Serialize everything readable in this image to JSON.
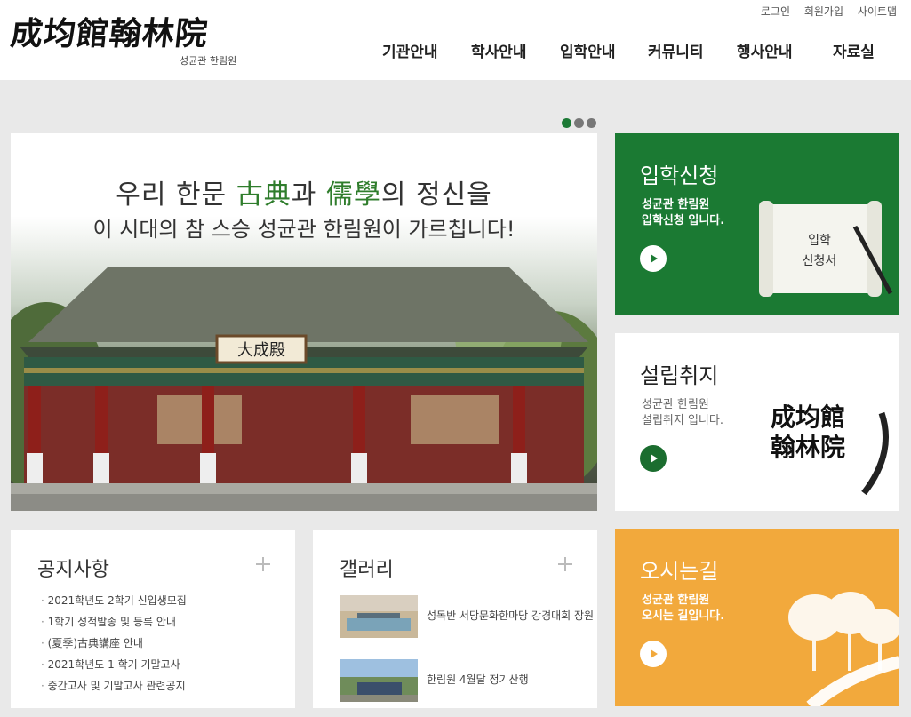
{
  "header": {
    "logo_hanja": "成均館翰林院",
    "logo_sub": "성균관 한림원",
    "util": {
      "login": "로그인",
      "join": "회원가입",
      "sitemap": "사이트맵"
    },
    "nav": [
      "기관안내",
      "학사안내",
      "입학안내",
      "커뮤니티",
      "행사안내",
      "자료실"
    ]
  },
  "hero": {
    "line1_pre": "우리 한문 ",
    "line1_hanja1": "古典",
    "line1_mid": "과 ",
    "line1_hanja2": "儒學",
    "line1_post": "의 정신을",
    "line2": "이 시대의 참 스승 성균관 한림원이 가르칩니다!",
    "plaque": "大成殿",
    "slides": 3,
    "active_slide": 1
  },
  "cards": {
    "apply": {
      "title": "입학신청",
      "desc_line1": "성균관 한림원",
      "desc_line2": "입학신청 입니다.",
      "scroll_text_1": "입학",
      "scroll_text_2": "신청서"
    },
    "purpose": {
      "title": "설립취지",
      "desc_line1": "성균관 한림원",
      "desc_line2": "설립취지 입니다.",
      "calligraphy_1": "成均館",
      "calligraphy_2": "翰林院"
    },
    "directions": {
      "title": "오시는길",
      "desc_line1": "성균관 한림원",
      "desc_line2": "오시는 길입니다."
    }
  },
  "notice": {
    "title": "공지사항",
    "items": [
      "2021학년도 2학기 신입생모집",
      "1학기 성적발송 및 등록 안내",
      "(夏季)古典講座 안내",
      "2021학년도 1 학기 기말고사",
      "중간고사 및 기말고사 관련공지"
    ]
  },
  "gallery": {
    "title": "갤러리",
    "items": [
      {
        "title": "성독반 서당문화한마당 강경대회 장원"
      },
      {
        "title": "한림원 4월달 정기산행"
      }
    ]
  },
  "colors": {
    "green": "#1b7a33",
    "orange": "#f2a93c",
    "background": "#e9e9e9"
  }
}
